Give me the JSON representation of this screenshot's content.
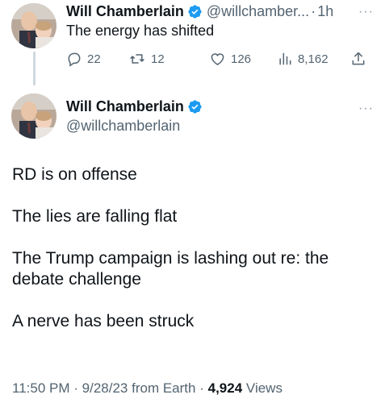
{
  "reply_tweet": {
    "name": "Will Chamberlain",
    "handle": "@willchamber...",
    "separator": "·",
    "time": "1h",
    "text": "The energy has shifted",
    "replies": "22",
    "retweets": "12",
    "likes": "126",
    "views": "8,162",
    "more": "···"
  },
  "main_tweet": {
    "name": "Will Chamberlain",
    "handle": "@willchamberlain",
    "more": "···",
    "paragraphs": [
      "RD is on offense",
      "The lies are falling flat",
      "The Trump campaign is lashing out re: the debate challenge",
      "A nerve has been struck"
    ],
    "time": "11:50 PM",
    "date": "9/28/23",
    "source": "from Earth",
    "views_count": "4,924",
    "views_label": "Views",
    "separator": "·"
  },
  "colors": {
    "verified": "#1d9bf0",
    "secondary_text": "#536471",
    "primary_text": "#0f1419",
    "thread_line": "#cfd9de"
  },
  "icons": [
    "verified-badge-icon",
    "reply-icon",
    "retweet-icon",
    "like-icon",
    "views-icon",
    "share-icon",
    "more-icon"
  ]
}
